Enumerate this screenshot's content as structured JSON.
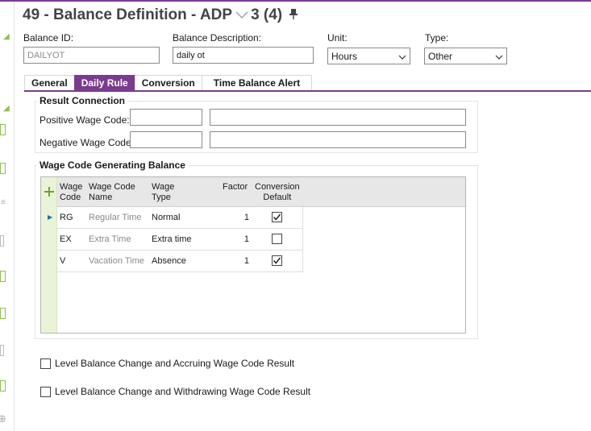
{
  "header": {
    "title": "49 - Balance Definition - ADP",
    "record_position": "3 (4)"
  },
  "fields": {
    "balance_id": {
      "label": "Balance ID:",
      "value": "DAILYOT"
    },
    "balance_description": {
      "label": "Balance Description:",
      "value": "daily ot"
    },
    "unit": {
      "label": "Unit:",
      "value": "Hours"
    },
    "type": {
      "label": "Type:",
      "value": "Other"
    }
  },
  "tabs": [
    {
      "label": "General",
      "active": false
    },
    {
      "label": "Daily Rule",
      "active": true
    },
    {
      "label": "Conversion",
      "active": false
    },
    {
      "label": "Time Balance Alert",
      "active": false
    }
  ],
  "result_connection": {
    "title": "Result Connection",
    "positive_label": "Positive Wage Code:",
    "positive_code": "",
    "positive_name": "",
    "negative_label": "Negative Wage Code:",
    "negative_code": "",
    "negative_name": ""
  },
  "wage_grid": {
    "title": "Wage Code Generating Balance",
    "add_icon": "plus-icon",
    "columns": {
      "wage_code": "Wage\nCode",
      "wage_code_name": "Wage Code\nName",
      "wage_type": "Wage\nType",
      "factor": "Factor",
      "conversion_default": "Conversion\nDefault"
    },
    "rows": [
      {
        "code": "RG",
        "name": "Regular Time",
        "type": "Normal",
        "factor": "1",
        "conversion_default": true,
        "current": true
      },
      {
        "code": "EX",
        "name": "Extra Time",
        "type": "Extra time",
        "factor": "1",
        "conversion_default": false,
        "current": false
      },
      {
        "code": "V",
        "name": "Vacation Time",
        "type": "Absence",
        "factor": "1",
        "conversion_default": true,
        "current": false
      }
    ]
  },
  "options": {
    "level_accruing": {
      "label": "Level Balance Change and Accruing Wage Code Result",
      "checked": false
    },
    "level_withdrawing": {
      "label": "Level Balance Change and Withdrawing Wage Code Result",
      "checked": false
    }
  },
  "colors": {
    "accent": "#7a3b8f",
    "grid_side": "#e9f3d8",
    "add_green": "#6aa52a"
  }
}
